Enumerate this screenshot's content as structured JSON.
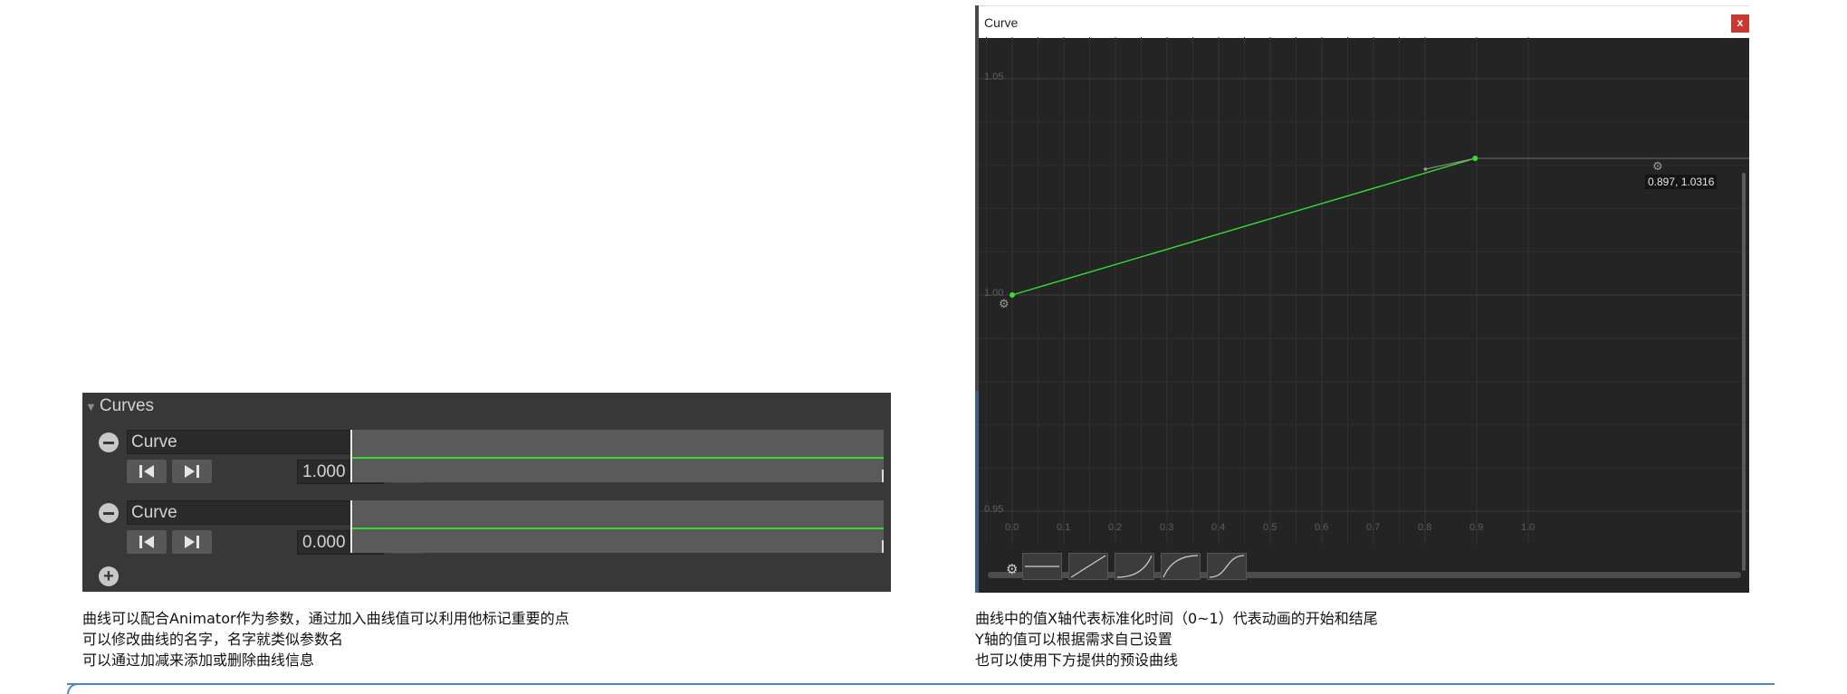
{
  "curves_panel": {
    "header": "Curves",
    "entries": [
      {
        "name": "Curve",
        "value": "1.000",
        "line_color": "#35dd33"
      },
      {
        "name": "Curve",
        "value": "0.000",
        "line_color": "#35dd33"
      }
    ]
  },
  "captions": {
    "left": [
      "曲线可以配合Animator作为参数，通过加入曲线值可以利用他标记重要的点",
      "可以修改曲线的名字，名字就类似参数名",
      "可以通过加减来添加或删除曲线信息"
    ],
    "right": [
      "曲线中的值X轴代表标准化时间（0~1）代表动画的开始和结尾",
      "Y轴的值可以根据需求自己设置",
      "也可以使用下方提供的预设曲线"
    ]
  },
  "curve_window": {
    "title": "Curve",
    "close_label": "x",
    "y_labels": [
      "1.05",
      "1.00",
      "0.95"
    ],
    "x_labels": [
      "0.0",
      "0.1",
      "0.2",
      "0.3",
      "0.4",
      "0.5",
      "0.6",
      "0.7",
      "0.8",
      "0.9",
      "1.0"
    ],
    "tooltip": "0.897, 1.0316",
    "curve_color": "#35dd33",
    "presets": [
      "flat",
      "linear",
      "ease-in",
      "ease-out",
      "ease-in-out"
    ]
  },
  "chart_data": {
    "type": "line",
    "x": [
      0.0,
      0.897
    ],
    "y": [
      1.0,
      1.0316
    ],
    "xlim": [
      0.0,
      1.0
    ],
    "ylim": [
      0.95,
      1.05
    ]
  }
}
